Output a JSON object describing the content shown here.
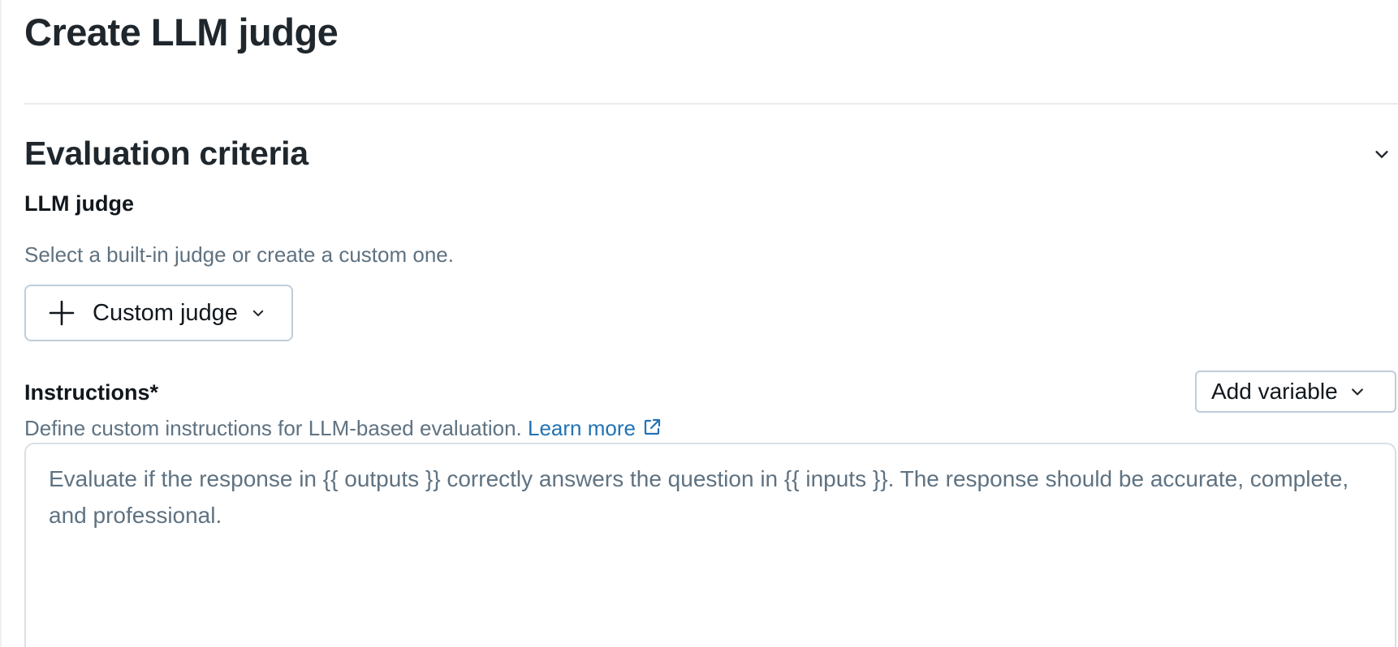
{
  "page": {
    "title": "Create LLM judge"
  },
  "section": {
    "title": "Evaluation criteria",
    "collapse_icon": "chevron-down-icon"
  },
  "judge": {
    "label": "LLM judge",
    "help": "Select a built-in judge or create a custom one.",
    "selected": "Custom judge",
    "icon": "plus-icon"
  },
  "instructions": {
    "label": "Instructions*",
    "help": "Define custom instructions for LLM-based evaluation.",
    "learn_more": "Learn more",
    "learn_more_icon": "external-link-icon",
    "add_variable": "Add variable",
    "placeholder": "Evaluate if the response in {{ outputs }} correctly answers the question in {{ inputs }}. The response should be accurate, complete, and professional."
  },
  "colors": {
    "link": "#2272b4",
    "border": "#c0cdd8",
    "muted_text": "#5f7281"
  }
}
